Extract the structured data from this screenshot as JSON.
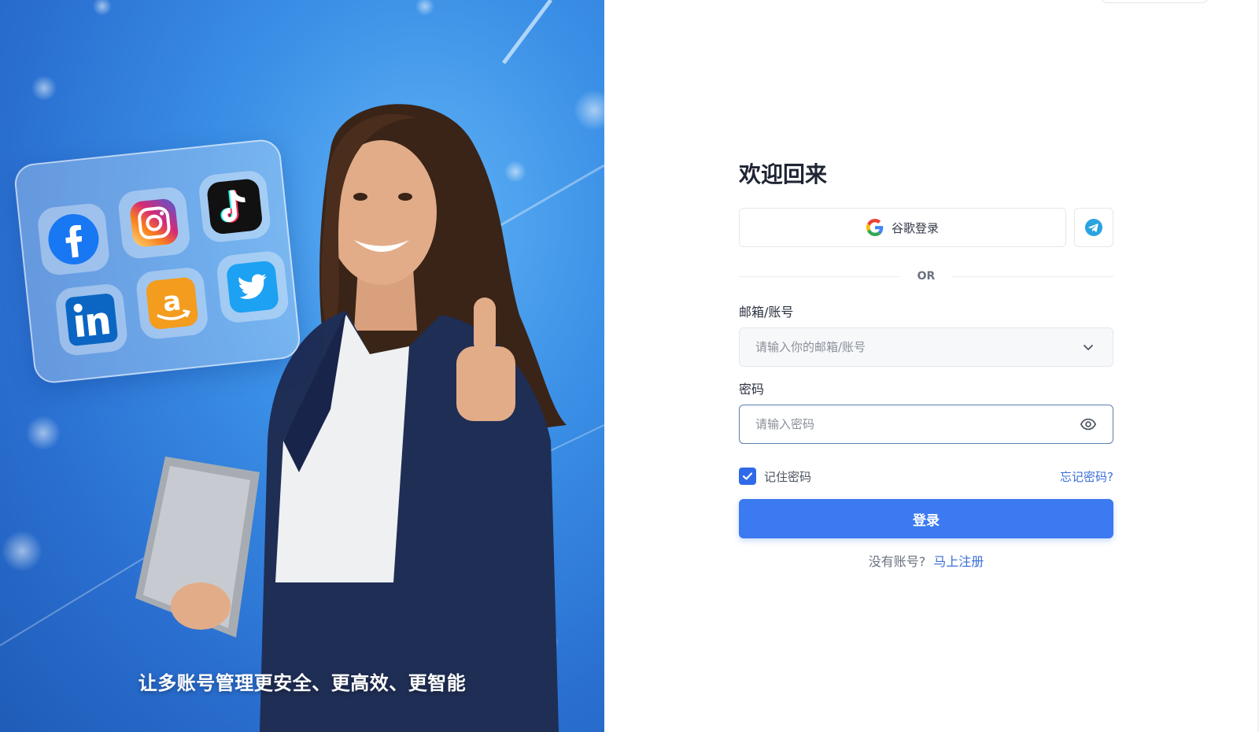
{
  "hero": {
    "caption": "让多账号管理更安全、更高效、更智能",
    "apps": [
      "facebook-icon",
      "instagram-icon",
      "tiktok-icon",
      "linkedin-icon",
      "amazon-icon",
      "twitter-icon"
    ]
  },
  "login": {
    "title": "欢迎回来",
    "google_label": "谷歌登录",
    "or_text": "OR",
    "account_label": "邮箱/账号",
    "account_placeholder": "请输入你的邮箱/账号",
    "password_label": "密码",
    "password_placeholder": "请输入密码",
    "remember_label": "记住密码",
    "remember_checked": true,
    "forgot_label": "忘记密码?",
    "submit_label": "登录",
    "no_account_text": "没有账号?",
    "register_label": "马上注册"
  },
  "colors": {
    "primary": "#3b7af0",
    "link": "#3a6fd8",
    "hero_blue": "#3a8fe6"
  }
}
